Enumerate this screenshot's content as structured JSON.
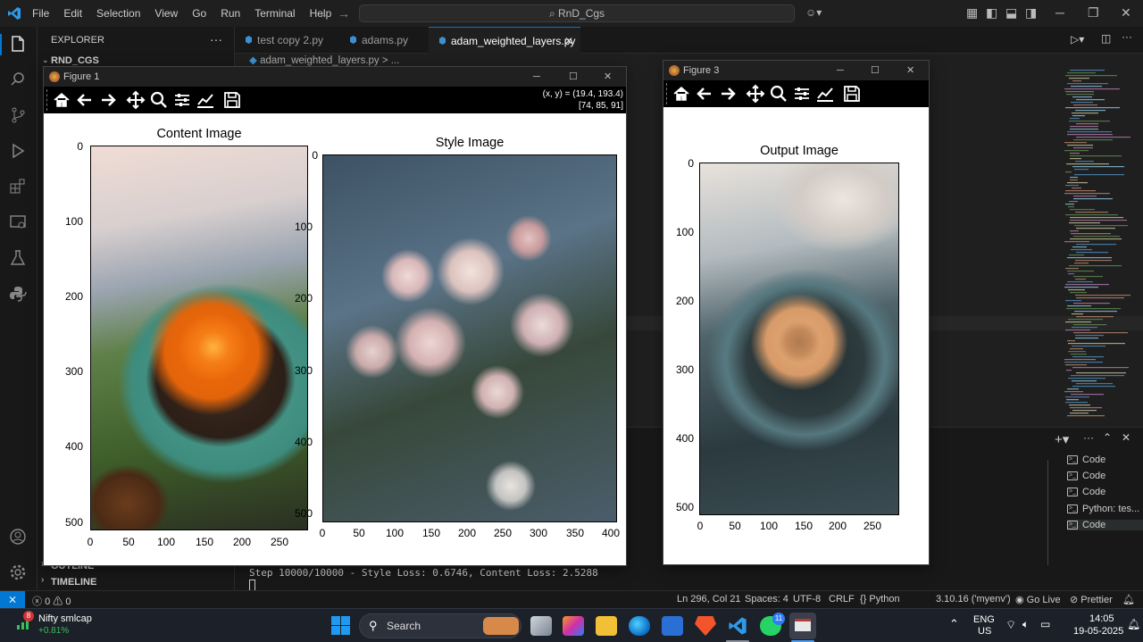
{
  "menu": [
    "File",
    "Edit",
    "Selection",
    "View",
    "Go",
    "Run",
    "Terminal",
    "Help"
  ],
  "command_center": "RnD_Cgs",
  "sidebar": {
    "header": "EXPLORER",
    "root": "RND_CGS",
    "outline": "OUTLINE",
    "timeline": "TIMELINE"
  },
  "tabs": [
    {
      "label": "test copy 2.py"
    },
    {
      "label": "adams.py"
    },
    {
      "label": "adam_weighted_layers.py",
      "active": true
    }
  ],
  "breadcrumb": {
    "file": "adam_weighted_layers.py",
    "rest": "> ..."
  },
  "terminal": {
    "output": "Step 10000/10000 - Style Loss: 0.6746, Content Loss: 2.5288",
    "sessions": [
      "Code",
      "Code",
      "Code",
      "Python: tes...",
      "Code"
    ]
  },
  "statusbar": {
    "errors": "0",
    "warnings": "0",
    "position": "Ln 296, Col 21",
    "spaces": "Spaces: 4",
    "encoding": "UTF-8",
    "eol": "CRLF",
    "language": "Python",
    "interpreter": "3.10.16 ('myenv')",
    "golive": "Go Live",
    "prettier": "Prettier"
  },
  "taskbar": {
    "stock_name": "Nifty smlcap",
    "stock_change": "+0.81%",
    "stock_badge": "8",
    "search": "Search",
    "lang1": "ENG",
    "lang2": "US",
    "time": "14:05",
    "date": "19-05-2025",
    "whatsapp_badge": "11"
  },
  "figure1": {
    "title": "Figure 1",
    "coords": "(x, y) = (19.4, 193.4)",
    "pixel": "[74, 85, 91]",
    "content_title": "Content Image",
    "style_title": "Style Image",
    "content_y": [
      "0",
      "100",
      "200",
      "300",
      "400",
      "500"
    ],
    "content_x": [
      "0",
      "50",
      "100",
      "150",
      "200",
      "250"
    ],
    "style_y": [
      "0",
      "100",
      "200",
      "300",
      "400",
      "500"
    ],
    "style_x": [
      "0",
      "50",
      "100",
      "150",
      "200",
      "250",
      "300",
      "350",
      "400"
    ]
  },
  "figure3": {
    "title": "Figure 3",
    "output_title": "Output Image",
    "y": [
      "0",
      "100",
      "200",
      "300",
      "400",
      "500"
    ],
    "x": [
      "0",
      "50",
      "100",
      "150",
      "200",
      "250"
    ]
  }
}
